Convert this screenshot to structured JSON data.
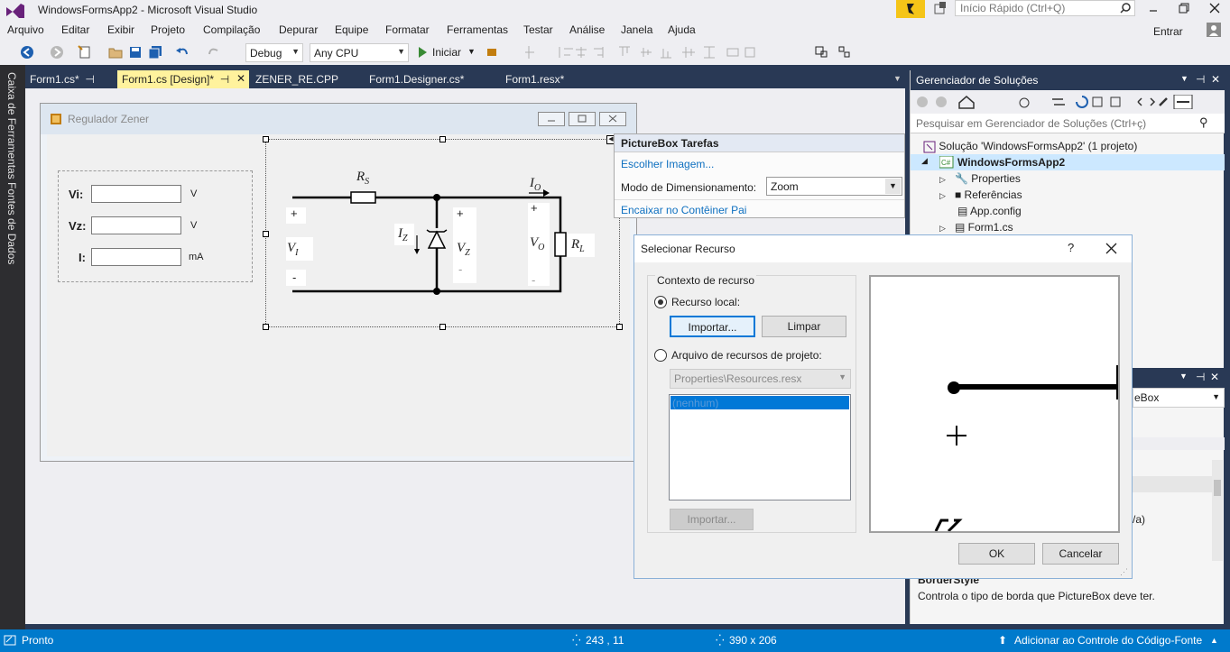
{
  "window": {
    "title": "WindowsFormsApp2 - Microsoft Visual Studio",
    "quick_launch_placeholder": "Início Rápido (Ctrl+Q)",
    "signin": "Entrar"
  },
  "menu": [
    "Arquivo",
    "Editar",
    "Exibir",
    "Projeto",
    "Compilação",
    "Depurar",
    "Equipe",
    "Formatar",
    "Ferramentas",
    "Testar",
    "Análise",
    "Janela",
    "Ajuda"
  ],
  "toolbar": {
    "config": "Debug",
    "platform": "Any CPU",
    "start_label": "Iniciar"
  },
  "left_panels": {
    "toolbox": "Caixa de Ferramentas",
    "datasources": "Fontes de Dados"
  },
  "tabs": [
    {
      "label": "Form1.cs*",
      "pin": "⊣"
    },
    {
      "label": "Form1.cs [Design]*",
      "pin": "⊣"
    },
    {
      "label": "ZENER_RE.CPP"
    },
    {
      "label": "Form1.Designer.cs*"
    },
    {
      "label": "Form1.resx*"
    }
  ],
  "form": {
    "title": "Regulador Zener",
    "rows": [
      {
        "label": "Vi:",
        "unit": "V"
      },
      {
        "label": "Vz:",
        "unit": "V"
      },
      {
        "label": "I:",
        "unit": "mA"
      }
    ],
    "circuit": {
      "rs": "R",
      "rs_sub": "S",
      "io": "I",
      "io_sub": "O",
      "iz": "I",
      "iz_sub": "Z",
      "vz": "V",
      "vz_sub": "Z",
      "vi": "V",
      "vi_sub": "I",
      "vo": "V",
      "vo_sub": "O",
      "rl": "R",
      "rl_sub": "L",
      "plus": "+",
      "minus": "-"
    }
  },
  "smart_tag": {
    "title": "PictureBox Tarefas",
    "choose_image": "Escolher Imagem...",
    "size_mode_label": "Modo de Dimensionamento:",
    "size_mode_value": "Zoom",
    "dock": "Encaixar no Contêiner Pai"
  },
  "solution_explorer": {
    "title": "Gerenciador de Soluções",
    "search_placeholder": "Pesquisar em Gerenciador de Soluções (Ctrl+ç)",
    "items": [
      {
        "label": "Solução 'WindowsFormsApp2' (1 projeto)",
        "icon": "solution-icon"
      },
      {
        "label": "WindowsFormsApp2",
        "icon": "csharp-project-icon",
        "selected": true
      },
      {
        "label": "Properties",
        "icon": "wrench-icon"
      },
      {
        "label": "Referências",
        "icon": "references-icon"
      },
      {
        "label": "App.config",
        "icon": "config-file-icon"
      },
      {
        "label": "Form1.cs",
        "icon": "form-icon"
      }
    ]
  },
  "properties": {
    "combo_fragment": "eBox",
    "row_fragment": "/a)",
    "desc_title": "BorderStyle",
    "desc_text": "Controla o tipo de borda que PictureBox deve ter."
  },
  "dialog": {
    "title": "Selecionar Recurso",
    "help": "?",
    "group_title": "Contexto de recurso",
    "local_resource": "Recurso local:",
    "import": "Importar...",
    "clear": "Limpar",
    "project_resource": "Arquivo de recursos de projeto:",
    "resx_value": "Properties\\Resources.resx",
    "list_item": "(nenhum)",
    "import_disabled": "Importar...",
    "ok": "OK",
    "cancel": "Cancelar"
  },
  "status": {
    "ready": "Pronto",
    "position": "243 , 11",
    "size": "390 x 206",
    "source_control": "Adicionar ao Controle do Código-Fonte"
  },
  "colors": {
    "accent": "#007acc",
    "tab_active": "#fff29d",
    "chrome": "#eeeef2",
    "dark": "#293955"
  }
}
